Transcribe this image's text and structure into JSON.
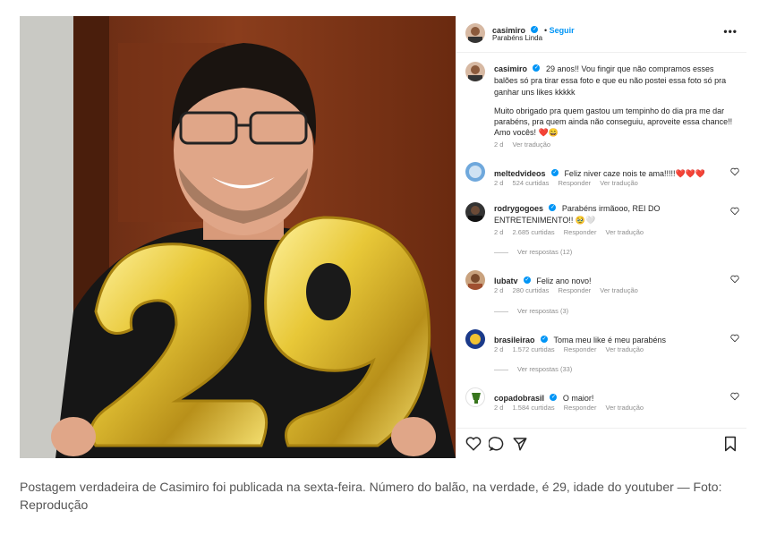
{
  "post": {
    "author": "casimiro",
    "follow_label": "Seguir",
    "location": "Parabéns Linda",
    "more_icon": "more-horizontal-icon",
    "caption_user": "casimiro",
    "caption_text_1": "29 anos!! Vou fingir que não compramos esses balões só pra tirar essa foto e que eu não postei essa foto só pra ganhar uns likes kkkkk",
    "caption_text_2": "Muito obrigado pra quem gastou um tempinho do dia pra me dar parabéns, pra quem ainda não conseguiu, aproveite essa chance!! Amo vocês! ❤️😄",
    "caption_time": "2 d",
    "caption_translate": "Ver tradução"
  },
  "comments": [
    {
      "user": "meltedvideos",
      "text": "Feliz niver caze nois te ama!!!!!❤️❤️❤️",
      "time": "2 d",
      "likes": "524 curtidas",
      "reply": "Responder",
      "translate": "Ver tradução",
      "replies": ""
    },
    {
      "user": "rodrygogoes",
      "text": "Parabéns irmãooo, REI DO ENTRETENIMENTO!! 🥹🤍",
      "time": "2 d",
      "likes": "2.685 curtidas",
      "reply": "Responder",
      "translate": "Ver tradução",
      "replies": "Ver respostas (12)"
    },
    {
      "user": "lubatv",
      "text": "Feliz ano novo!",
      "time": "2 d",
      "likes": "280 curtidas",
      "reply": "Responder",
      "translate": "Ver tradução",
      "replies": "Ver respostas (3)"
    },
    {
      "user": "brasileirao",
      "text": "Toma meu like é meu parabéns",
      "time": "2 d",
      "likes": "1.572 curtidas",
      "reply": "Responder",
      "translate": "Ver tradução",
      "replies": "Ver respostas (33)"
    },
    {
      "user": "copadobrasil",
      "text": "O maior!",
      "time": "2 d",
      "likes": "1.584 curtidas",
      "reply": "Responder",
      "translate": "Ver tradução",
      "replies": ""
    }
  ],
  "photo": {
    "balloon_text": "29",
    "balloon_color": "#d9b520"
  },
  "page": {
    "caption": "Postagem verdadeira de Casimiro foi publicada na sexta-feira. Número do balão, na verdade, é 29, idade do youtuber — Foto: Reprodução"
  },
  "colors": {
    "accent": "#0095f6",
    "heart": "#ed4956",
    "meta": "#8e8e8e"
  }
}
